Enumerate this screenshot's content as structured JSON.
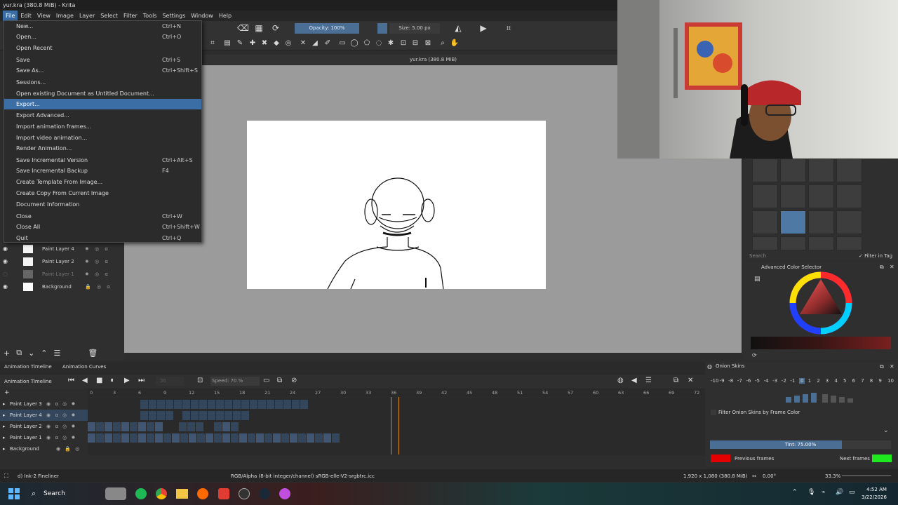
{
  "window": {
    "title": "yur.kra (380.8 MiB) - Krita",
    "doc_tab": "yur.kra (380.8 MiB)"
  },
  "menubar": [
    "File",
    "Edit",
    "View",
    "Image",
    "Layer",
    "Select",
    "Filter",
    "Tools",
    "Settings",
    "Window",
    "Help"
  ],
  "toolbar": {
    "opacity": "Opacity: 100%",
    "size": "Size: 5.00 px"
  },
  "file_menu": [
    {
      "label": "New...",
      "shortcut": "Ctrl+N"
    },
    {
      "label": "Open...",
      "shortcut": "Ctrl+O"
    },
    {
      "label": "Open Recent",
      "shortcut": ""
    },
    {
      "label": "Save",
      "shortcut": "Ctrl+S"
    },
    {
      "label": "Save As...",
      "shortcut": "Ctrl+Shift+S"
    },
    {
      "label": "Sessions...",
      "shortcut": ""
    },
    {
      "label": "Open existing Document as Untitled Document...",
      "shortcut": ""
    },
    {
      "label": "Export...",
      "shortcut": ""
    },
    {
      "label": "Export Advanced...",
      "shortcut": ""
    },
    {
      "label": "Import animation frames...",
      "shortcut": ""
    },
    {
      "label": "Import video animation...",
      "shortcut": ""
    },
    {
      "label": "Render Animation...",
      "shortcut": ""
    },
    {
      "label": "Save Incremental Version",
      "shortcut": "Ctrl+Alt+S"
    },
    {
      "label": "Save Incremental Backup",
      "shortcut": "F4"
    },
    {
      "label": "Create Template From Image...",
      "shortcut": ""
    },
    {
      "label": "Create Copy From Current Image",
      "shortcut": ""
    },
    {
      "label": "Document Information",
      "shortcut": ""
    },
    {
      "label": "Close",
      "shortcut": "Ctrl+W"
    },
    {
      "label": "Close All",
      "shortcut": "Ctrl+Shift+W"
    },
    {
      "label": "Quit",
      "shortcut": "Ctrl+Q"
    }
  ],
  "layers": [
    "Paint Layer 4",
    "Paint Layer 2",
    "Paint Layer 1",
    "Background"
  ],
  "brush_panel": {
    "search_placeholder": "Search",
    "filter_label": "Filter in Tag"
  },
  "color_selector": {
    "title": "Advanced Color Selector"
  },
  "timeline": {
    "tabs": [
      "Animation Timeline",
      "Animation Curves"
    ],
    "title": "Animation Timeline",
    "frame_value": "36",
    "speed": "Speed: 70 %",
    "ruler": [
      "0",
      "3",
      "6",
      "9",
      "12",
      "15",
      "18",
      "21",
      "24",
      "27",
      "30",
      "33",
      "36",
      "39",
      "42",
      "45",
      "48",
      "51",
      "54",
      "57",
      "60",
      "63",
      "66",
      "69",
      "72"
    ],
    "layers": [
      "Paint Layer 3",
      "Paint Layer 4",
      "Paint Layer 2",
      "Paint Layer 1",
      "Background"
    ],
    "current_frame": 36
  },
  "onion": {
    "title": "Onion Skins",
    "numbers": [
      "-10",
      "-9",
      "-8",
      "-7",
      "-6",
      "-5",
      "-4",
      "-3",
      "-2",
      "-1",
      "0",
      "1",
      "2",
      "3",
      "4",
      "5",
      "6",
      "7",
      "8",
      "9",
      "10"
    ],
    "filter_label": "Filter Onion Skins by Frame Color",
    "tint": "Tint: 75.00%",
    "tint_fraction": 0.73,
    "previous_label": "Previous frames",
    "next_label": "Next frames",
    "previous_color": "#e40000",
    "next_color": "#1ee81e"
  },
  "status": {
    "brush": "d) Ink-2 Fineliner",
    "color_profile": "RGB/Alpha (8-bit integer/channel)  sRGB-elle-V2-srgbtrc.icc",
    "dimensions": "1,920 x 1,080 (380.8 MiB)",
    "rotation": "0.00°",
    "zoom": "33.3%"
  },
  "taskbar": {
    "search": "Search",
    "time": "4:52 AM",
    "date": "3/22/2026"
  },
  "colors": {
    "accent": "#3b6ea5",
    "playhead": "#e38e21",
    "frame_cell": "#405672"
  }
}
